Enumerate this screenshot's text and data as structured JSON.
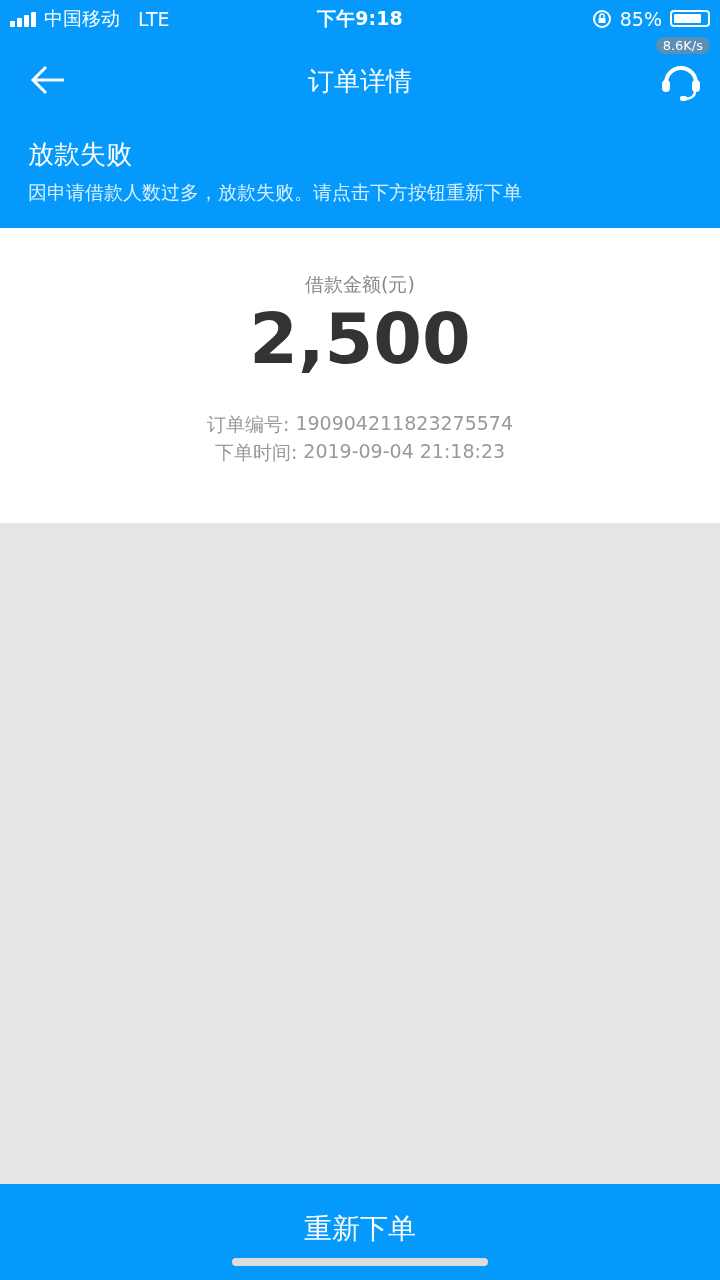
{
  "status_bar": {
    "carrier": "中国移动",
    "network": "LTE",
    "time": "下午9:18",
    "battery": {
      "percent": "85%",
      "level": 0.85
    },
    "net_speed": "8.6K/s"
  },
  "nav": {
    "title": "订单详情"
  },
  "banner": {
    "title": "放款失败",
    "message": "因申请借款人数过多，放款失败。请点击下方按钮重新下单"
  },
  "amount": {
    "label": "借款金额(元)",
    "value": "2,500"
  },
  "details": [
    {
      "label": "订单编号:",
      "value": "190904211823275574"
    },
    {
      "label": "下单时间:",
      "value": "2019-09-04 21:18:23"
    }
  ],
  "action_button": "重新下单"
}
